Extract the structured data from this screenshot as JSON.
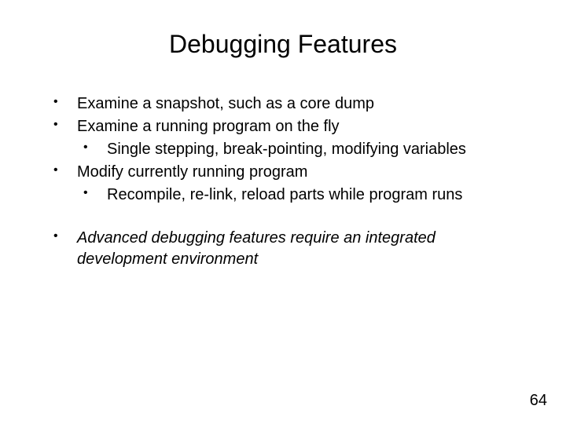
{
  "title": "Debugging Features",
  "bullets": {
    "b1": "Examine a snapshot, such as a core dump",
    "b2": "Examine a running program on the fly",
    "b2a": "Single stepping, break-pointing, modifying variables",
    "b3": "Modify currently running program",
    "b3a": "Recompile, re-link, reload parts while program runs",
    "b4": "Advanced debugging features require an integrated development environment"
  },
  "page_number": "64"
}
